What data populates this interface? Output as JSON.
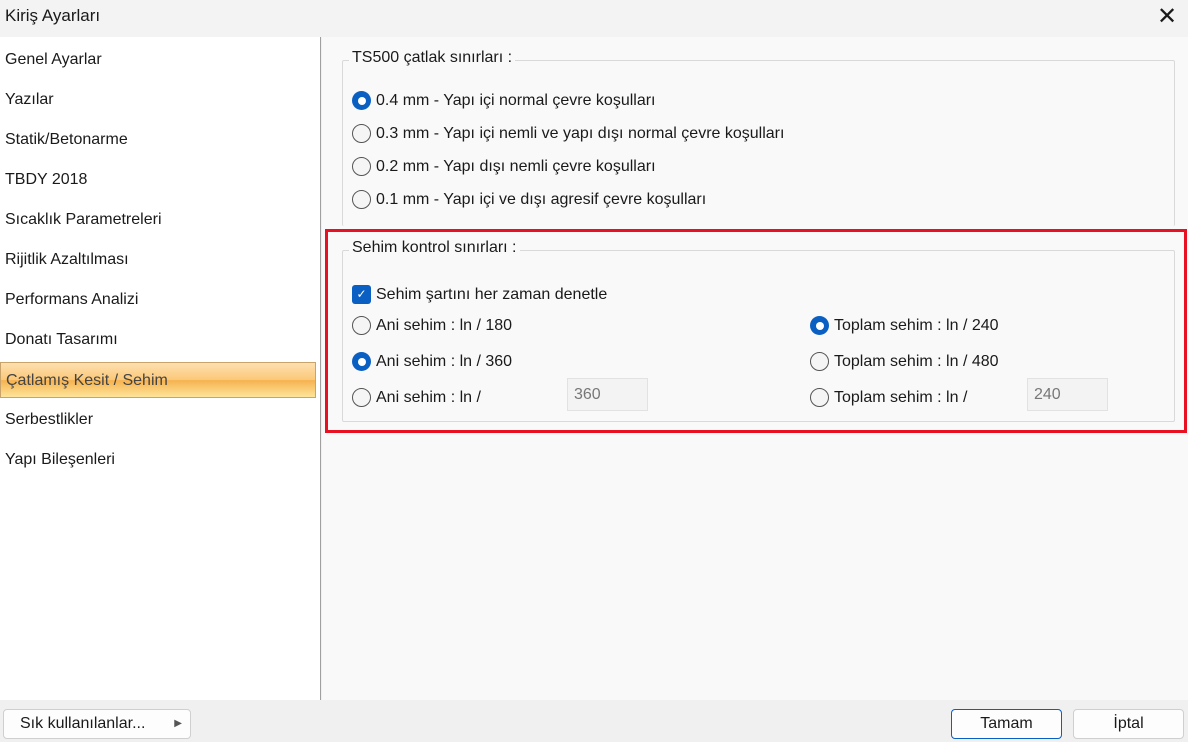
{
  "window": {
    "title": "Kiriş Ayarları",
    "close_icon": "close-icon"
  },
  "sidebar": {
    "items": [
      "Genel Ayarlar",
      "Yazılar",
      "Statik/Betonarme",
      "TBDY 2018",
      "Sıcaklık Parametreleri",
      "Rijitlik Azaltılması",
      "Performans Analizi",
      "Donatı Tasarımı",
      "Çatlamış Kesit / Sehim",
      "Serbestlikler",
      "Yapı Bileşenleri"
    ],
    "selected": "Çatlamış Kesit / Sehim"
  },
  "crack": {
    "title": "TS500 çatlak sınırları :",
    "options": [
      "0.4 mm - Yapı içi normal çevre koşulları",
      "0.3 mm - Yapı içi nemli ve yapı dışı normal çevre koşulları",
      "0.2 mm - Yapı dışı nemli çevre koşulları",
      "0.1 mm - Yapı içi ve dışı agresif çevre koşulları"
    ],
    "selected": 0
  },
  "deflection": {
    "title": "Sehim kontrol sınırları :",
    "always_check": "Sehim şartını her zaman denetle",
    "always_checked": true,
    "instant": [
      "Ani sehim : ln / 180",
      "Ani sehim : ln / 360",
      "Ani sehim : ln /"
    ],
    "instant_selected": 1,
    "instant_custom": "360",
    "total": [
      "Toplam sehim  : ln / 240",
      "Toplam sehim : ln / 480",
      "Toplam sehim : ln /"
    ],
    "total_selected": 0,
    "total_custom": "240"
  },
  "footer": {
    "favorites": "Sık kullanılanlar...",
    "ok": "Tamam",
    "cancel": "İptal"
  }
}
